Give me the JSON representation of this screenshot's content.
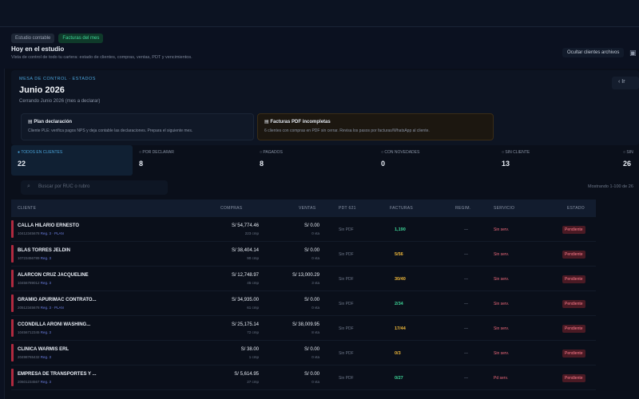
{
  "header": {
    "badges": [
      "Estudio contable",
      "Facturas del mes"
    ],
    "title": "Hoy en el estudio",
    "subtitle": "Vista de control de todo tu cartera: estado de clientes, compras, ventas, PDT y vencimientos.",
    "button_label": "Ocultar clientes archivos",
    "icon": "sidebar-icon"
  },
  "period": {
    "kicker": "MESA DE CONTROL · ESTADOS",
    "title": "Junio 2026",
    "subtitle": "Cerrando Junio 2026 (mes a declarar)",
    "nav_label": "‹   Ir",
    "alerts": [
      {
        "title": "Plan declaración",
        "desc": "Cliente PLE: verifica pagos NPS y deja contable las declaraciones. Prepara el siguiente mes.",
        "icon": "calendar-icon"
      },
      {
        "title": "Facturas PDF incompletas",
        "desc": "6 clientes con compras en PDF sin cerrar. Revisa los pasos por facturas/WhatsApp al cliente.",
        "icon": "file-icon"
      }
    ]
  },
  "stats": [
    {
      "label": "TODOS EN CLIENTES",
      "value": "22",
      "active": true,
      "icon": "users-icon"
    },
    {
      "label": "POR DECLARAR",
      "value": "8",
      "active": false,
      "icon": "clock-icon"
    },
    {
      "label": "PAGADOS",
      "value": "8",
      "active": false,
      "icon": "check-icon"
    },
    {
      "label": "CON NOVEDADES",
      "value": "0",
      "active": false,
      "icon": "alert-icon"
    },
    {
      "label": "SIN CLIENTE",
      "value": "13",
      "active": false,
      "icon": "user-icon"
    },
    {
      "label": "SIN",
      "value": "26",
      "active": false,
      "icon": "tag-icon"
    }
  ],
  "filters": {
    "search_placeholder": "Buscar por RUC o rubro",
    "count": "Mostrando 1-100 de 26"
  },
  "table": {
    "headers": [
      "CLIENTE",
      "COMPRAS",
      "VENTAS",
      "PDT 621",
      "FACTURAS",
      "REGIM.",
      "SERVICIO",
      "ESTADO"
    ],
    "rows": [
      {
        "name": "CALLA HILARIO ERNESTO",
        "sub": "10412345678",
        "tag": "Reg. 3 · PLAN",
        "c1": "S/ 54,774.46",
        "c1s": "223 cmp",
        "c2": "S/ 0.00",
        "c2s": "0 vta",
        "pdf": "Sin PDF",
        "fac": "1,190",
        "fac_color": "#3ed598",
        "reg": "—",
        "srv": "Sin serv.",
        "est": "Pendiente"
      },
      {
        "name": "BLAS TORRES JELDIN",
        "sub": "10723456789",
        "tag": "Reg. 3",
        "c1": "S/ 38,404.14",
        "c1s": "90 cmp",
        "c2": "S/ 0.00",
        "c2s": "0 vta",
        "pdf": "Sin PDF",
        "fac": "5/56",
        "fac_color": "#f0b93a",
        "reg": "—",
        "srv": "Sin serv.",
        "est": "Pendiente"
      },
      {
        "name": "ALARCON CRUZ JACQUELINE",
        "sub": "10456789012",
        "tag": "Reg. 3",
        "c1": "S/ 12,748.97",
        "c1s": "45 cmp",
        "c2": "S/ 13,000.29",
        "c2s": "3 vta",
        "pdf": "Sin PDF",
        "fac": "30/40",
        "fac_color": "#f0b93a",
        "reg": "—",
        "srv": "Sin serv.",
        "est": "Pendiente"
      },
      {
        "name": "GRAMIO APURIMAC CONTRATO...",
        "sub": "20512345678",
        "tag": "Reg. 3 · PLAN",
        "c1": "S/ 34,935.00",
        "c1s": "61 cmp",
        "c2": "S/ 0.00",
        "c2s": "0 vta",
        "pdf": "Sin PDF",
        "fac": "2/34",
        "fac_color": "#3ed598",
        "reg": "—",
        "srv": "Sin serv.",
        "est": "Pendiente"
      },
      {
        "name": "CCONDILLA ARONI WASHING...",
        "sub": "10456712345",
        "tag": "Reg. 3",
        "c1": "S/ 25,175.14",
        "c1s": "72 cmp",
        "c2": "S/ 38,009.95",
        "c2s": "8 vta",
        "pdf": "Sin PDF",
        "fac": "17/44",
        "fac_color": "#f0b93a",
        "reg": "—",
        "srv": "Sin serv.",
        "est": "Pendiente"
      },
      {
        "name": "CLINICA WARMIS ERL",
        "sub": "20498765432",
        "tag": "Reg. 3",
        "c1": "S/ 38.00",
        "c1s": "1 cmp",
        "c2": "S/ 0.00",
        "c2s": "0 vta",
        "pdf": "Sin PDF",
        "fac": "0/3",
        "fac_color": "#f0b93a",
        "reg": "—",
        "srv": "Sin serv.",
        "est": "Pendiente"
      },
      {
        "name": "EMPRESA DE TRANSPORTES Y ...",
        "sub": "20601234567",
        "tag": "Reg. 3",
        "c1": "S/ 5,614.95",
        "c1s": "27 cmp",
        "c2": "S/ 0.00",
        "c2s": "0 vta",
        "pdf": "Sin PDF",
        "fac": "0/27",
        "fac_color": "#3ed598",
        "reg": "—",
        "srv": "Pd serv.",
        "est": "Pendiente"
      }
    ]
  }
}
